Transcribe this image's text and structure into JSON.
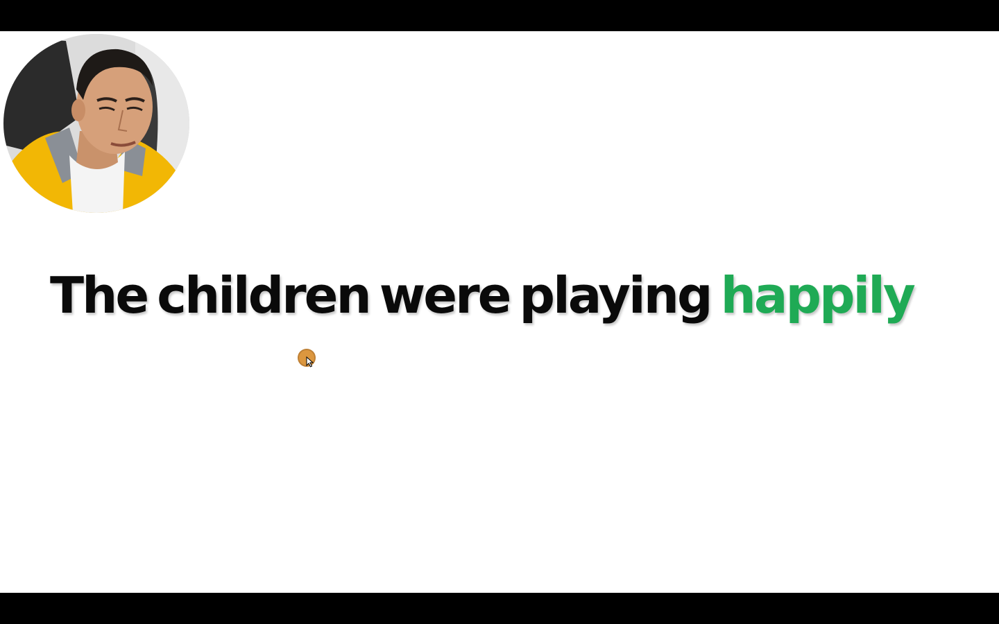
{
  "slide": {
    "sentence_plain": "The children were playing",
    "sentence_highlight": "happily",
    "highlight_color": "#1faa55",
    "text_color": "#0a0a0a",
    "background": "#ffffff"
  },
  "webcam": {
    "icon": "presenter-webcam"
  },
  "cursor": {
    "icon": "mouse-pointer-icon",
    "ring_color": "#d98c2b"
  }
}
